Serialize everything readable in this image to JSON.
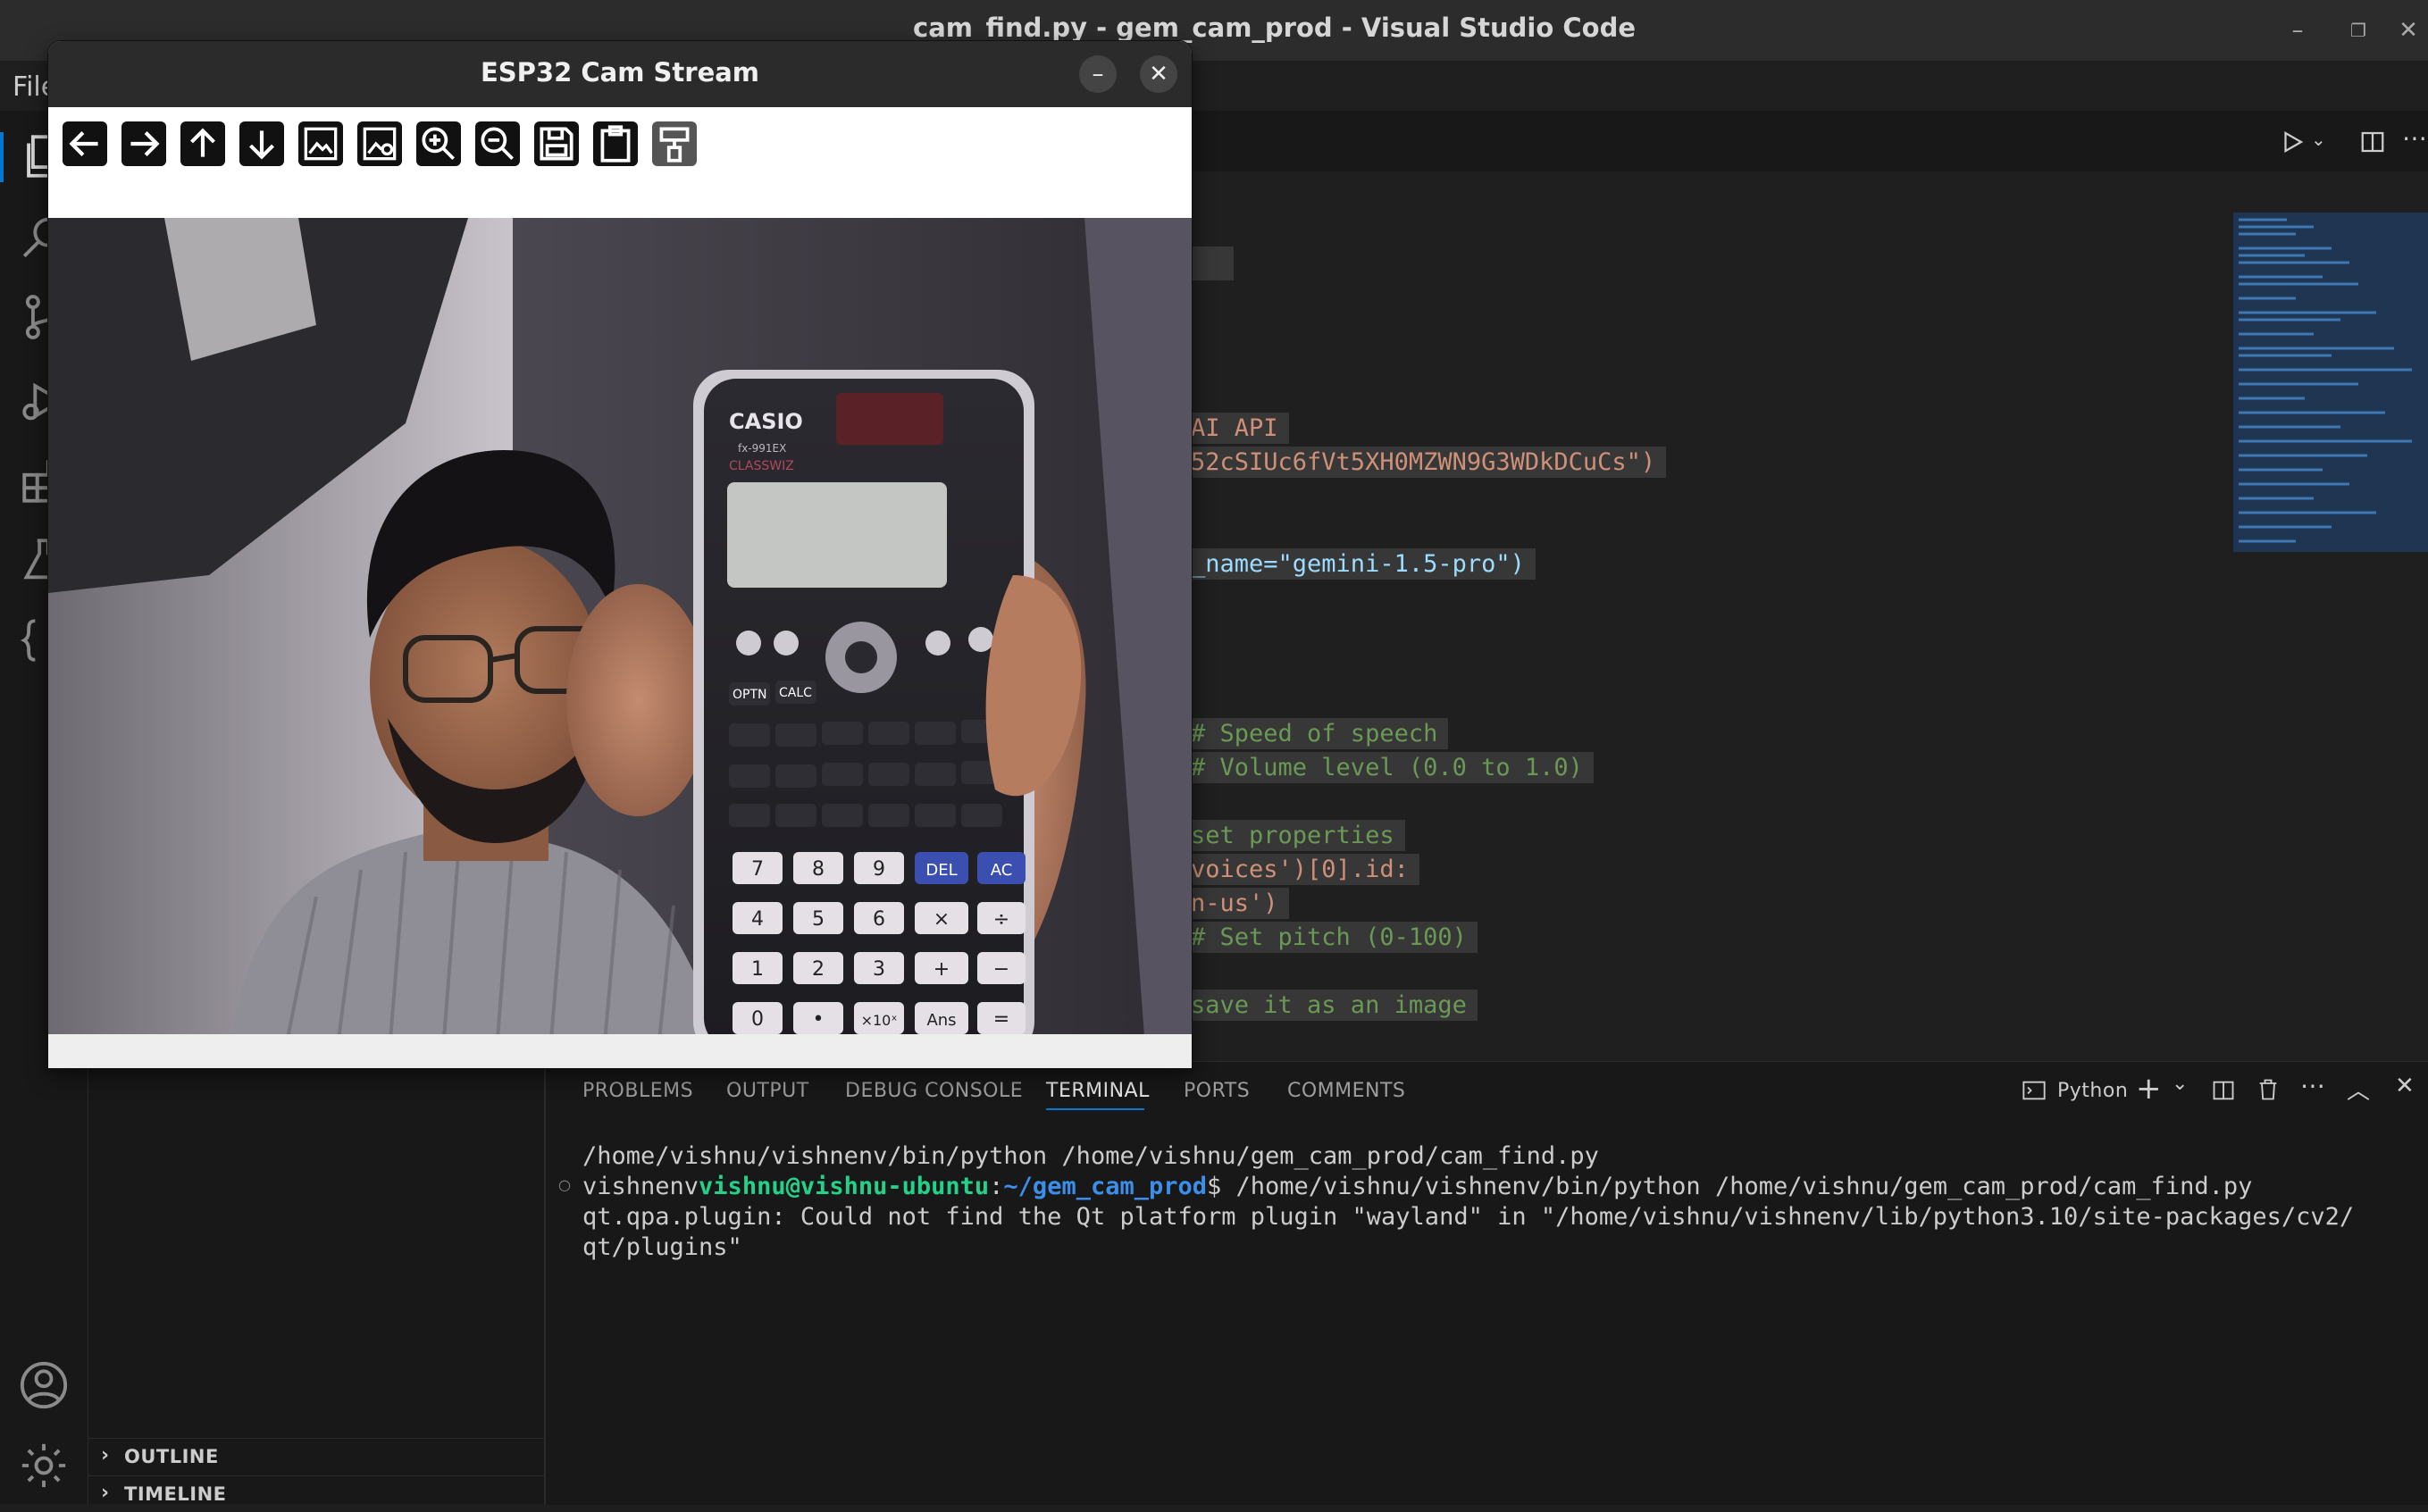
{
  "window": {
    "title": "cam_find.py - gem_cam_prod - Visual Studio Code",
    "minimize": "–",
    "restore": "❐",
    "close": "✕"
  },
  "menubar": {
    "file": "File"
  },
  "editor": {
    "lines": [
      {
        "text": "AI API"
      },
      {
        "text": "52cSIUc6fVt5XH0MZWN9G3WDkDCuCs\")"
      },
      {
        "text": "_name=\"gemini-1.5-pro\")"
      },
      {
        "text": "# Speed of speech"
      },
      {
        "text": "# Volume level (0.0 to 1.0)"
      },
      {
        "text": "set properties"
      },
      {
        "text": "voices')[0].id:"
      },
      {
        "text": "n-us')"
      },
      {
        "text": "# Set pitch (0-100)"
      },
      {
        "text": "save it as an image"
      }
    ]
  },
  "panel": {
    "tabs": [
      "PROBLEMS",
      "OUTPUT",
      "DEBUG CONSOLE",
      "TERMINAL",
      "PORTS",
      "COMMENTS"
    ],
    "active_tab": "TERMINAL",
    "terminal_profile": "Python",
    "terminal": {
      "line1": "/home/vishnu/vishnenv/bin/python /home/vishnu/gem_cam_prod/cam_find.py",
      "env": "vishnenv",
      "user_host": "vishnu@vishnu-ubuntu",
      "path": "~/gem_cam_prod",
      "cmd": "$ /home/vishnu/vishnenv/bin/python /home/vishnu/gem_cam_prod/cam_find.py",
      "line3": "qt.qpa.plugin: Could not find the Qt platform plugin \"wayland\" in \"/home/vishnu/vishnenv/lib/python3.10/site-packages/cv2/",
      "line4": "qt/plugins\""
    }
  },
  "sidebar": {
    "outline": "OUTLINE",
    "timeline": "TIMELINE"
  },
  "camwin": {
    "title": "ESP32 Cam Stream",
    "minimize": "–",
    "close": "✕",
    "toolbar": [
      "arrow-left-icon",
      "arrow-right-icon",
      "arrow-up-icon",
      "arrow-down-icon",
      "image-icon",
      "image-settings-icon",
      "zoom-in-icon",
      "zoom-out-icon",
      "save-icon",
      "clipboard-icon",
      "properties-icon"
    ]
  },
  "calculator": {
    "brand": "CASIO",
    "model": "fx-991EX",
    "series": "CLASSWIZ",
    "keys_row1": [
      "OPTN",
      "CALC"
    ],
    "keys_num": [
      [
        "7",
        "8",
        "9",
        "DEL",
        "AC"
      ],
      [
        "4",
        "5",
        "6",
        "×",
        "÷"
      ],
      [
        "1",
        "2",
        "3",
        "+",
        "−"
      ],
      [
        "0",
        "•",
        "×10ˣ",
        "Ans",
        "="
      ]
    ]
  }
}
